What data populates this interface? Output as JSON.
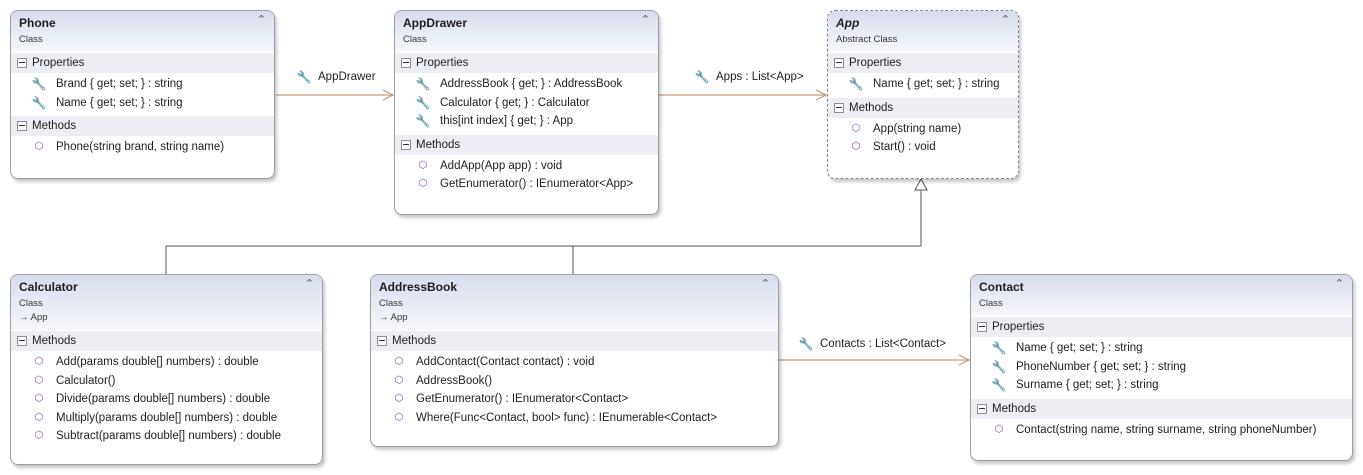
{
  "classes": {
    "phone": {
      "name": "Phone",
      "kind": "Class",
      "properties_header": "Properties",
      "properties": [
        "Brand { get; set; } : string",
        "Name { get; set; } : string"
      ],
      "methods_header": "Methods",
      "methods": [
        "Phone(string brand, string name)"
      ]
    },
    "appdrawer": {
      "name": "AppDrawer",
      "kind": "Class",
      "properties_header": "Properties",
      "properties": [
        "AddressBook { get; } : AddressBook",
        "Calculator { get; } : Calculator",
        "this[int index] { get; } : App"
      ],
      "methods_header": "Methods",
      "methods": [
        "AddApp(App app) : void",
        "GetEnumerator() : IEnumerator<App>"
      ]
    },
    "app": {
      "name": "App",
      "kind": "Abstract Class",
      "properties_header": "Properties",
      "properties": [
        "Name { get; set; } : string"
      ],
      "methods_header": "Methods",
      "methods": [
        "App(string name)",
        "Start() : void"
      ]
    },
    "calculator": {
      "name": "Calculator",
      "kind": "Class",
      "base": "App",
      "methods_header": "Methods",
      "methods": [
        "Add(params double[] numbers) : double",
        "Calculator()",
        "Divide(params double[] numbers) : double",
        "Multiply(params double[] numbers) : double",
        "Subtract(params double[] numbers) : double"
      ]
    },
    "addressbook": {
      "name": "AddressBook",
      "kind": "Class",
      "base": "App",
      "methods_header": "Methods",
      "methods": [
        "AddContact(Contact contact) : void",
        "AddressBook()",
        "GetEnumerator() : IEnumerator<Contact>",
        "Where(Func<Contact, bool> func) : IEnumerable<Contact>"
      ]
    },
    "contact": {
      "name": "Contact",
      "kind": "Class",
      "properties_header": "Properties",
      "properties": [
        "Name { get; set; } : string",
        "PhoneNumber { get; set; } : string",
        "Surname { get; set; } : string"
      ],
      "methods_header": "Methods",
      "methods": [
        "Contact(string name, string surname, string phoneNumber)"
      ]
    }
  },
  "associations": {
    "phone_appdrawer": "AppDrawer",
    "appdrawer_app": "Apps : List<App>",
    "addressbook_contact": "Contacts : List<Contact>"
  },
  "icons": {
    "property": "wrench-icon",
    "method": "method-cube-icon",
    "collapse": "chevron-up-icon",
    "base_arrow": "arrow-right-icon"
  },
  "colors": {
    "header_top": "#d6dcec",
    "section_bg": "#eceef3",
    "association_line": "#c79a7e",
    "inheritance_line": "#555555",
    "method_icon": "#8a4fb8"
  }
}
